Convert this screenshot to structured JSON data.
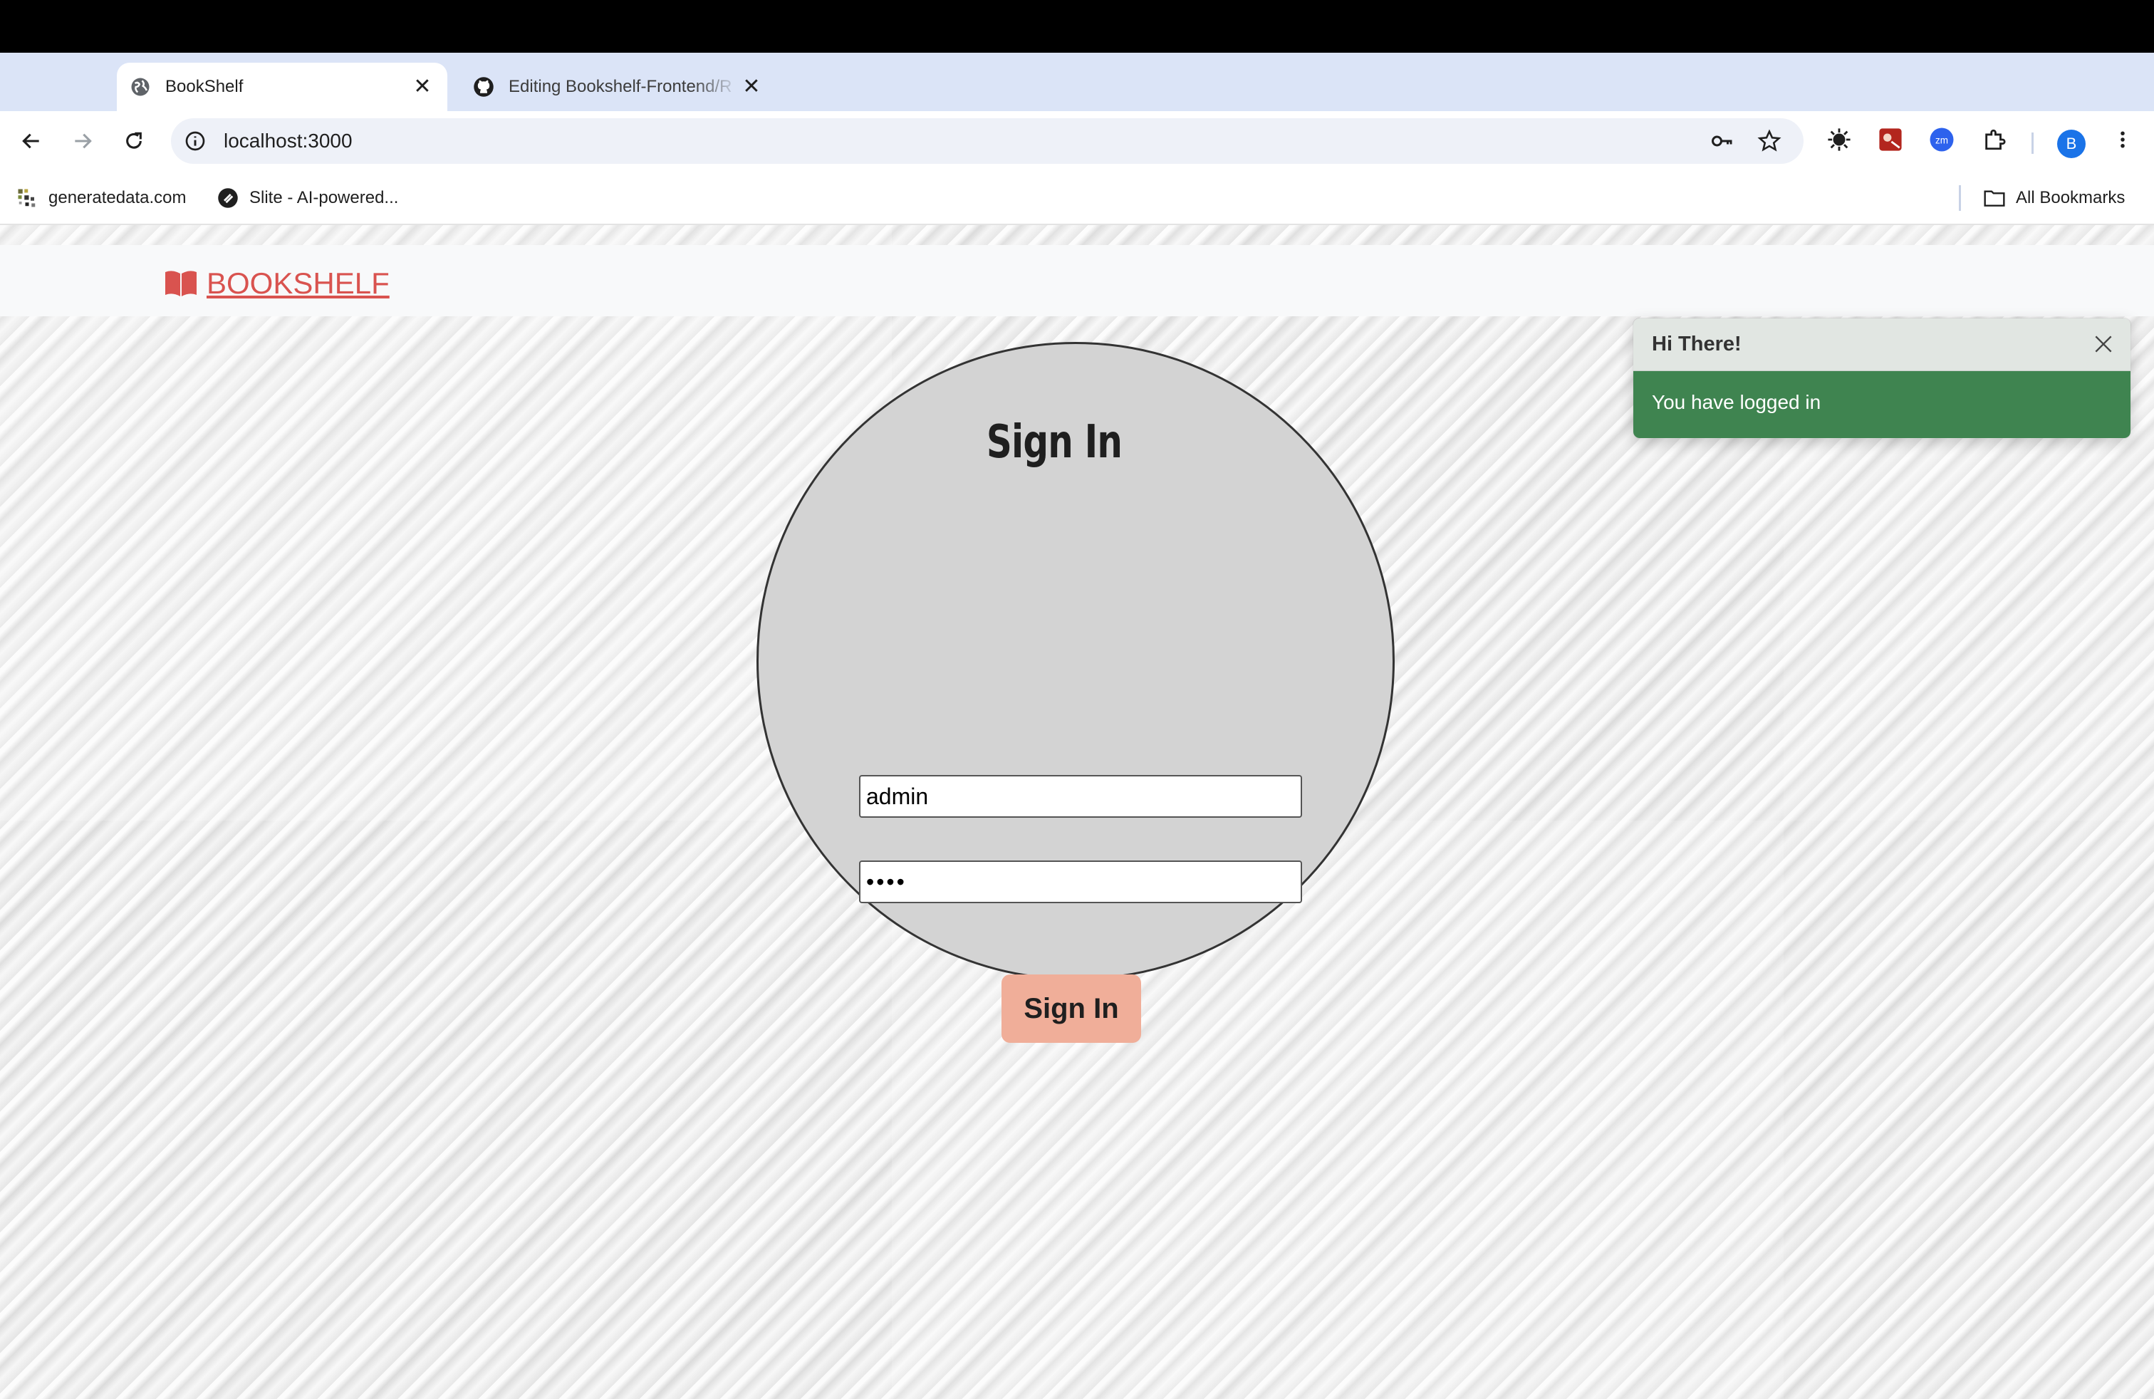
{
  "browser": {
    "tabs": [
      {
        "title": "BookShelf",
        "active": true
      },
      {
        "title": "Editing Bookshelf-Frontend/R",
        "active": false
      }
    ],
    "url": "localhost:3000",
    "profile_initial": "B",
    "bookmarks": [
      {
        "label": "generatedata.com"
      },
      {
        "label": "Slite - AI-powered..."
      }
    ],
    "all_bookmarks_label": "All Bookmarks"
  },
  "app": {
    "brand": "BOOKSHELF",
    "brand_color": "#d9534f"
  },
  "signin": {
    "title": "Sign In",
    "username_value": "admin",
    "password_value": "••••",
    "button_label": "Sign In",
    "button_color": "#f0ae99"
  },
  "toast": {
    "title": "Hi There!",
    "message": "You have logged in",
    "body_color": "#3f8450"
  }
}
